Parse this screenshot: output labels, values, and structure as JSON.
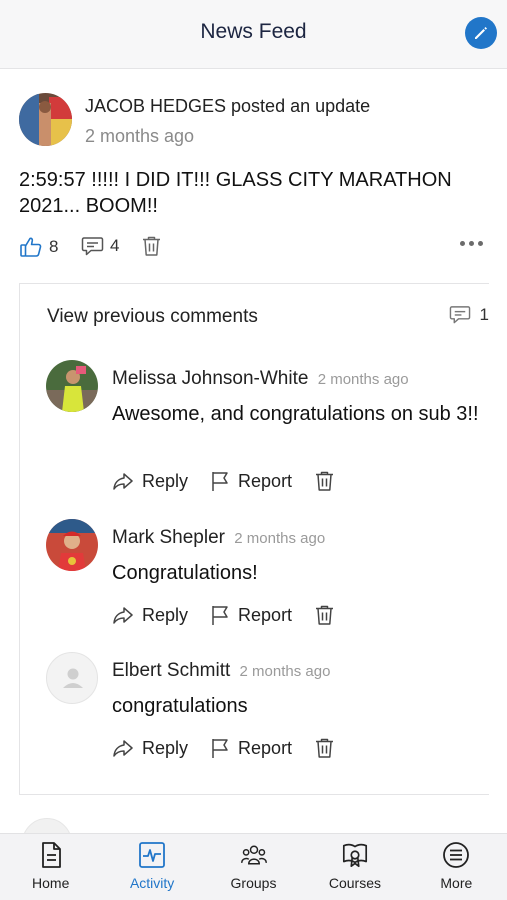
{
  "header": {
    "title": "News Feed",
    "compose_icon": "pencil-icon",
    "accent": "#2176c9"
  },
  "post": {
    "author_line": "JACOB HEDGES posted an update",
    "time": "2 months ago",
    "body": "2:59:57 !!!!!   I DID IT!!!  GLASS CITY  MARATHON 2021... BOOM!!",
    "likes": "8",
    "comments": "4",
    "icons": {
      "like": "thumbs-up-icon",
      "comment": "comment-icon",
      "delete": "trash-icon",
      "more": "more-dots-icon"
    }
  },
  "comments_section": {
    "view_previous": "View previous comments",
    "count": "1",
    "items": [
      {
        "name": "Melissa Johnson-White",
        "time": "2 months ago",
        "text": "Awesome, and congratulations on sub 3!!"
      },
      {
        "name": "Mark Shepler",
        "time": "2 months ago",
        "text": "Congratulations!"
      },
      {
        "name": "Elbert Schmitt",
        "time": "2 months ago",
        "text": "congratulations"
      }
    ],
    "actions": {
      "reply": "Reply",
      "report": "Report"
    }
  },
  "tabbar": {
    "items": [
      {
        "label": "Home",
        "icon": "document-icon",
        "active": false
      },
      {
        "label": "Activity",
        "icon": "activity-icon",
        "active": true
      },
      {
        "label": "Groups",
        "icon": "groups-icon",
        "active": false
      },
      {
        "label": "Courses",
        "icon": "courses-icon",
        "active": false
      },
      {
        "label": "More",
        "icon": "menu-icon",
        "active": false
      }
    ]
  }
}
